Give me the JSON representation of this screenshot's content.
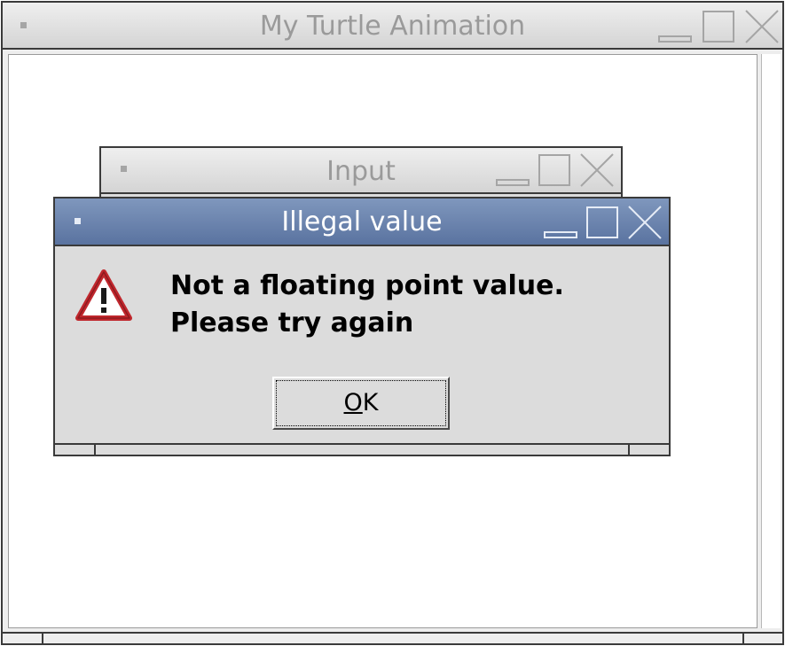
{
  "main_window": {
    "title": "My Turtle Animation",
    "controls": [
      "minimize-icon",
      "maximize-icon",
      "close-icon"
    ]
  },
  "input_dialog": {
    "title": "Input",
    "controls": [
      "minimize-icon",
      "maximize-icon",
      "close-icon"
    ]
  },
  "alert_dialog": {
    "title": "Illegal value",
    "icon": "warning-icon",
    "message_line1": "Not a floating point value.",
    "message_line2": "Please try again",
    "ok_button": {
      "mnemonic": "O",
      "rest": "K"
    },
    "controls": [
      "minimize-icon",
      "maximize-icon",
      "close-icon"
    ]
  },
  "colors": {
    "active_titlebar": "#5a73a0",
    "inactive_titlebar": "#d4d4d4",
    "dialog_background": "#dcdcdc",
    "warning_red": "#c0272d"
  }
}
